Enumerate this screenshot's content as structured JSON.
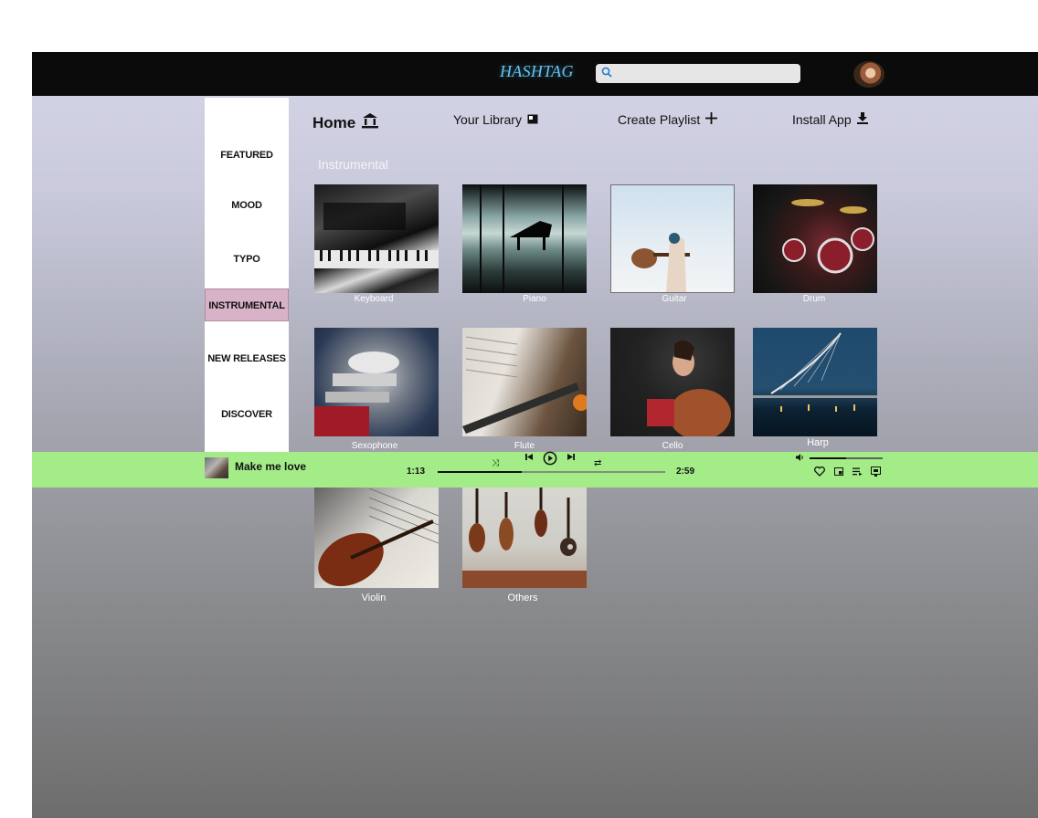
{
  "header": {
    "logo": "HASHTAG",
    "search_placeholder": ""
  },
  "sidebar": {
    "items": [
      {
        "label": "FEATURED"
      },
      {
        "label": "MOOD"
      },
      {
        "label": "TYPO"
      },
      {
        "label": "INSTRUMENTAL"
      },
      {
        "label": "NEW RELEASES"
      },
      {
        "label": "DISCOVER"
      }
    ],
    "active_color": "#d8b2c6"
  },
  "nav": {
    "home": "Home",
    "library": "Your Library",
    "create_playlist": "Create Playlist",
    "install_app": "Install App"
  },
  "section": {
    "title": "Instrumental"
  },
  "cards": [
    {
      "label": "Keyboard"
    },
    {
      "label": "Piano"
    },
    {
      "label": "Guitar"
    },
    {
      "label": "Drum"
    },
    {
      "label": "Sexophone"
    },
    {
      "label": "Flute"
    },
    {
      "label": "Cello"
    },
    {
      "label": "Harp"
    },
    {
      "label": "Violin"
    },
    {
      "label": "Others"
    }
  ],
  "player": {
    "track_title": "Make me love",
    "elapsed": "1:13",
    "duration": "2:59",
    "progress_fraction": 0.37,
    "volume_fraction": 0.5,
    "bar_color": "#a3ec88"
  },
  "colors": {
    "topbar": "#0b0b0b",
    "logo": "#62c4ee",
    "accent_active": "#d8b2c6"
  }
}
